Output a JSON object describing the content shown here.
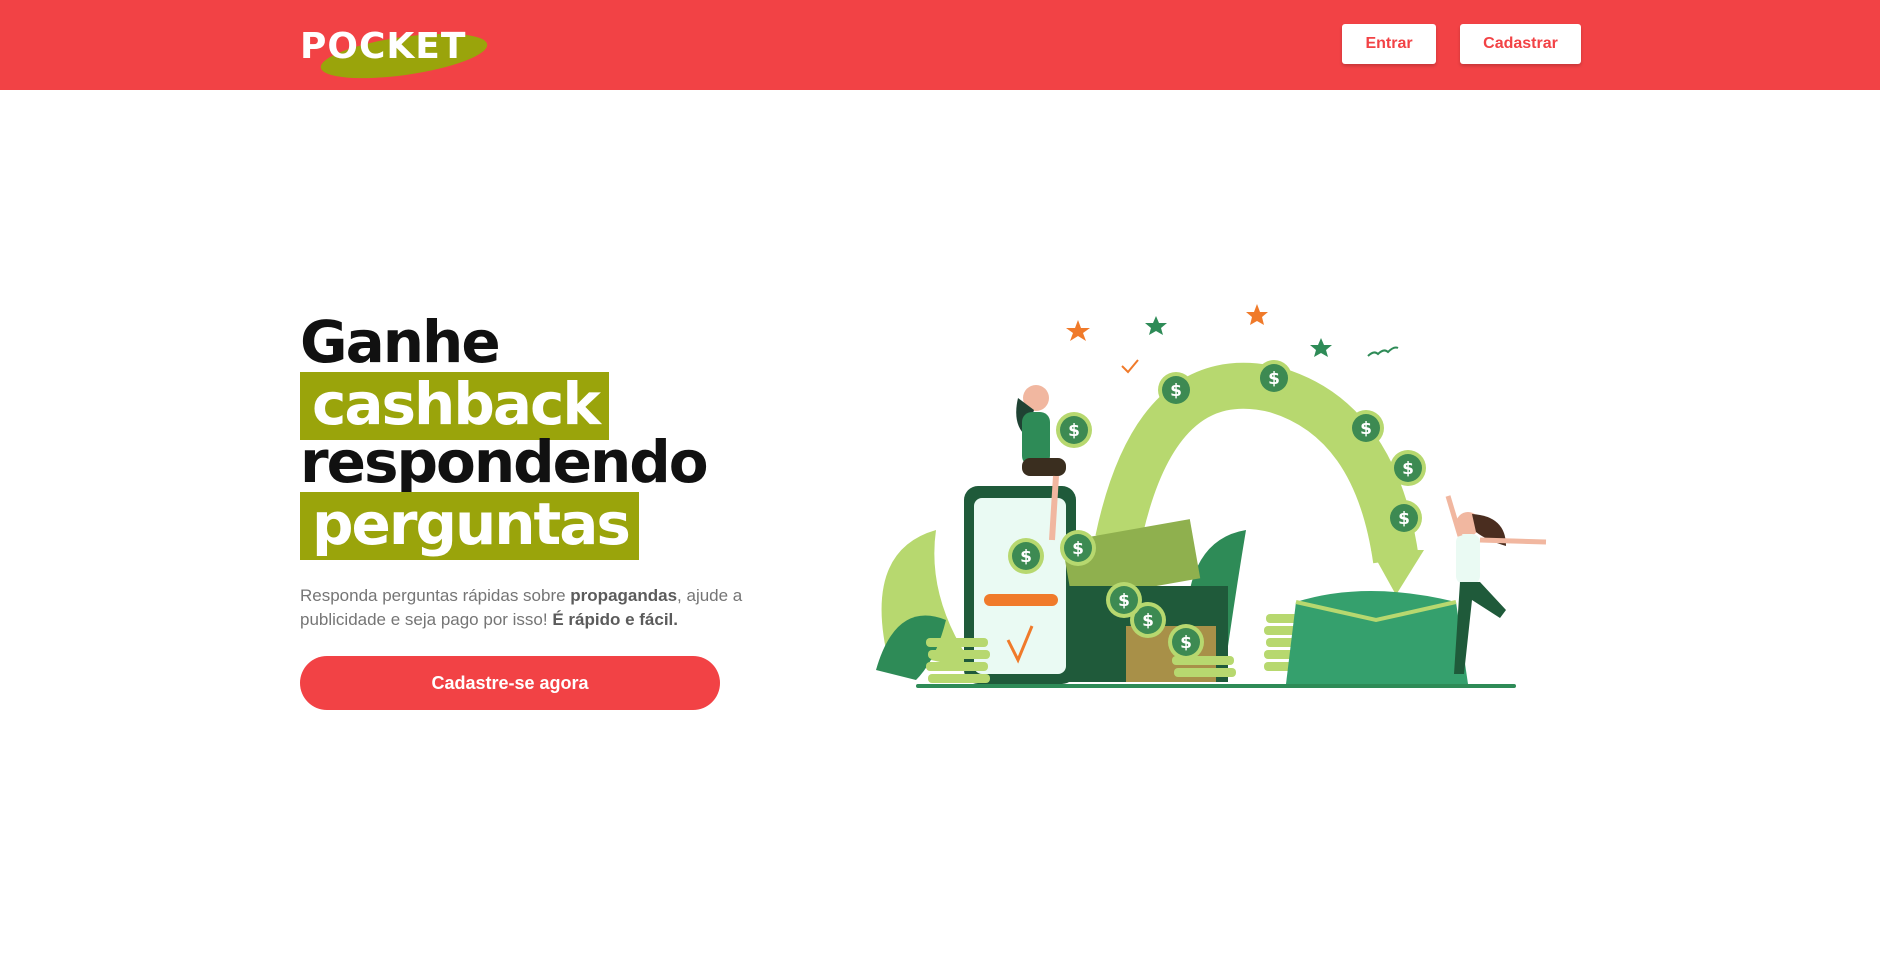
{
  "header": {
    "logo_text": "POCKET",
    "login_label": "Entrar",
    "signup_label": "Cadastrar"
  },
  "hero": {
    "title_line1": "Ganhe",
    "title_highlight1": "cashback",
    "title_line3": "respondendo",
    "title_highlight2": "perguntas",
    "desc_part1": "Responda perguntas rápidas sobre ",
    "desc_bold1": "propagandas",
    "desc_part2": ", ajude a publicidade e seja pago por isso! ",
    "desc_bold2": "É rápido e fácil.",
    "cta_label": "Cadastre-se agora"
  },
  "colors": {
    "brand_red": "#f24245",
    "highlight_olive": "#9aa40b",
    "illustration_green": "#2e7d4f",
    "illustration_light_green": "#b7d86f"
  },
  "icons": [
    "dollar-coin-icon",
    "star-icon",
    "checkmark-icon"
  ]
}
